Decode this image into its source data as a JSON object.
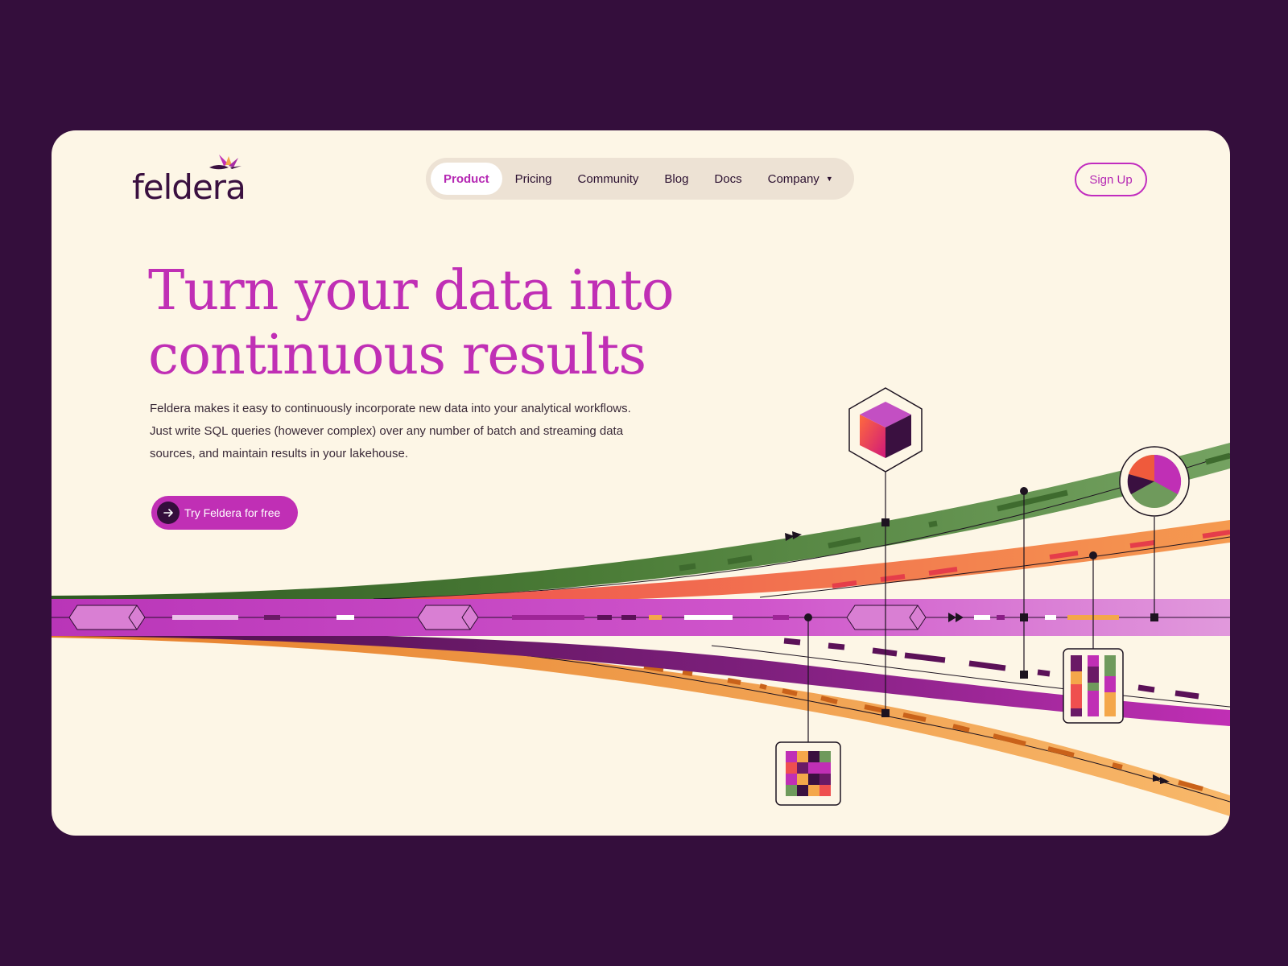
{
  "brand": {
    "name": "feldera",
    "logo_icon": "hummingbird-icon"
  },
  "nav": {
    "items": [
      {
        "label": "Product",
        "active": true
      },
      {
        "label": "Pricing",
        "active": false
      },
      {
        "label": "Community",
        "active": false
      },
      {
        "label": "Blog",
        "active": false
      },
      {
        "label": "Docs",
        "active": false
      },
      {
        "label": "Company",
        "active": false,
        "has_dropdown": true
      }
    ]
  },
  "header": {
    "signup_label": "Sign Up"
  },
  "hero": {
    "headline_line1": "Turn your data into",
    "headline_line2": "continuous results",
    "subtext": "Feldera makes it easy to continuously incorporate new data into your analytical workflows. Just write SQL queries (however complex) over any number of batch and streaming data sources, and maintain results in your lakehouse.",
    "cta_label": "Try Feldera for free",
    "cta_icon": "arrow-right-icon"
  },
  "colors": {
    "page_bg": "#340e3c",
    "card_bg": "#fdf6e6",
    "accent": "#c02fb5",
    "green": "#6f9a5c",
    "orange": "#f3905a",
    "magenta": "#c845c4",
    "amber": "#f3b061",
    "purple": "#8e2a8c"
  }
}
